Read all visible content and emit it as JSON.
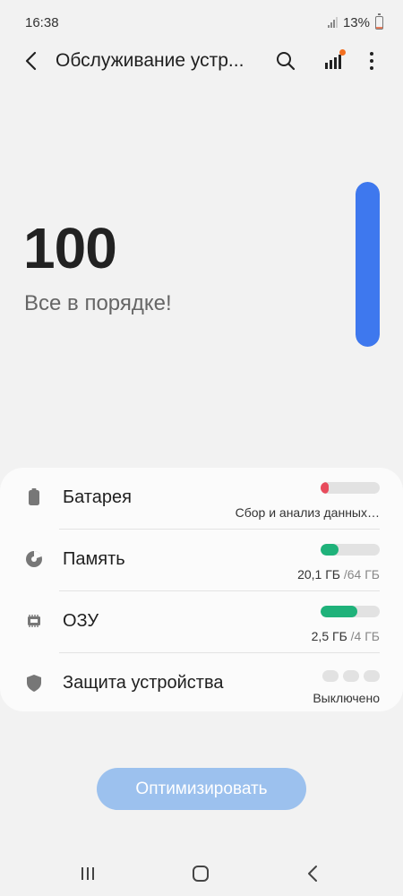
{
  "status": {
    "time": "16:38",
    "battery_text": "13%",
    "battery_level": 0.13,
    "battery_color": "#e87b5a"
  },
  "toolbar": {
    "title": "Обслуживание устр...",
    "back_icon": "chevron-left-icon",
    "search_icon": "search-icon",
    "stats_icon": "bar-chart-icon",
    "more_icon": "more-vertical-icon",
    "badge_color": "#f37021"
  },
  "score": {
    "value": "100",
    "message": "Все в порядке!",
    "level": 1.0,
    "bar_color": "#3e78ee"
  },
  "items": [
    {
      "label": "Батарея",
      "icon": "battery-icon",
      "value": "Сбор и анализ данных…",
      "meter": 0.14,
      "meter_color": "#e84b5c"
    },
    {
      "label": "Память",
      "icon": "pie-chart-icon",
      "value_main": "20,1 ГБ",
      "value_total": "/64 ГБ",
      "meter": 0.31,
      "meter_color": "#1fb27a"
    },
    {
      "label": "ОЗУ",
      "icon": "memory-chip-icon",
      "value_main": "2,5 ГБ",
      "value_total": "/4 ГБ",
      "meter": 0.62,
      "meter_color": "#1fb27a"
    },
    {
      "label": "Защита устройства",
      "icon": "shield-icon",
      "value": "Выключено"
    }
  ],
  "optimize_button": "Оптимизировать",
  "nav": {
    "recent_icon": "recent-apps-icon",
    "home_icon": "home-icon",
    "back_icon": "back-icon"
  }
}
